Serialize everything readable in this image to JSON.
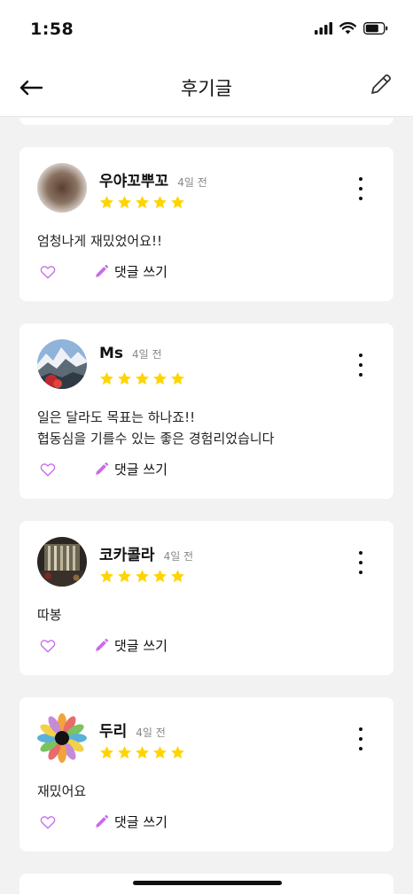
{
  "status_bar": {
    "time": "1:58",
    "icons": [
      "signal-icon",
      "wifi-icon",
      "battery-icon"
    ]
  },
  "header": {
    "back_icon": "arrow-left-icon",
    "title": "후기글",
    "edit_icon": "pencil-icon"
  },
  "colors": {
    "star": "#FFD400",
    "accent": "#C86BE8",
    "card": "#FFFFFF",
    "background": "#F2F2F2"
  },
  "reviews": [
    {
      "name": "우야꼬뿌꼬",
      "time": "4일 전",
      "rating": 5,
      "text": "엄청나게 재밌었어요!!",
      "like_icon": "heart-outline-icon",
      "comment_label": "댓글 쓰기"
    },
    {
      "name": "Ms",
      "time": "4일 전",
      "rating": 5,
      "text": "일은 달라도 목표는 하나죠!!\n협동심을 기를수 있는 좋은 경험리었습니다",
      "like_icon": "heart-outline-icon",
      "comment_label": "댓글 쓰기"
    },
    {
      "name": "코카콜라",
      "time": "4일 전",
      "rating": 5,
      "text": "따봉",
      "like_icon": "heart-outline-icon",
      "comment_label": "댓글 쓰기"
    },
    {
      "name": "두리",
      "time": "4일 전",
      "rating": 5,
      "text": "재밌어요",
      "like_icon": "heart-outline-icon",
      "comment_label": "댓글 쓰기"
    }
  ]
}
